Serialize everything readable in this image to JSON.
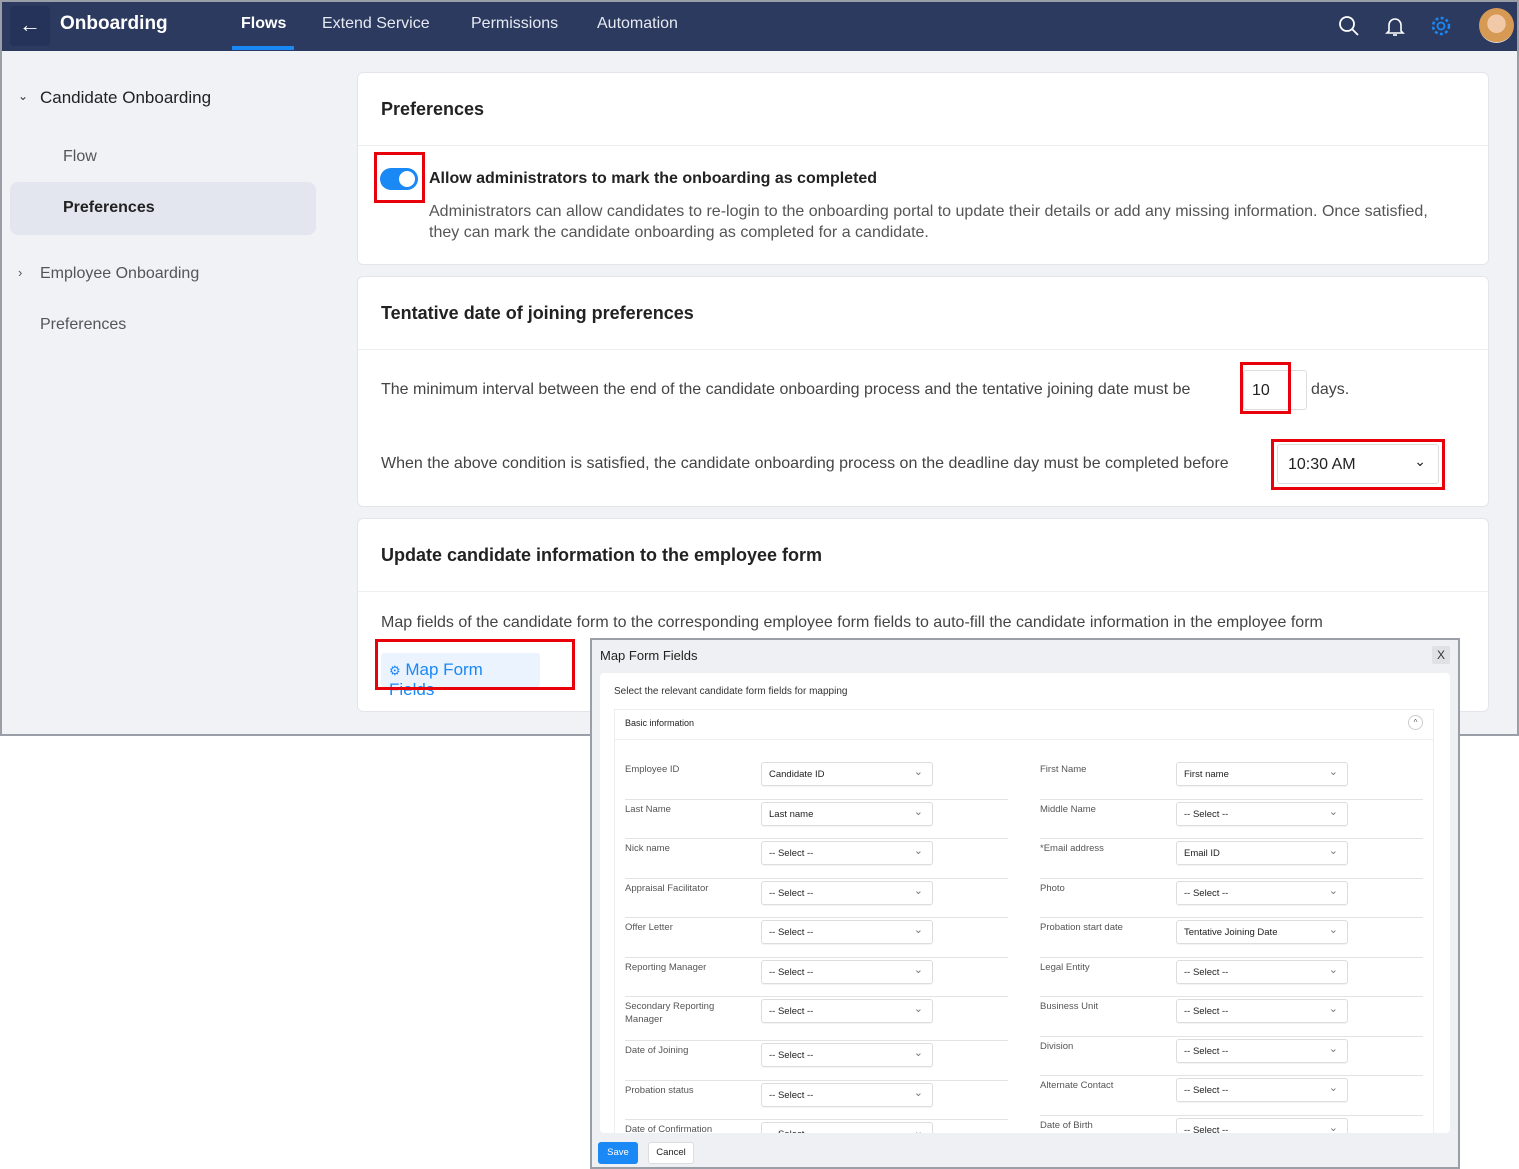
{
  "header": {
    "back_icon": "arrow-left-icon",
    "title": "Onboarding",
    "tabs": [
      "Flows",
      "Extend Service",
      "Permissions",
      "Automation"
    ],
    "active_tab": "Flows",
    "accent": "#1a88f5"
  },
  "sidebar": {
    "group1": "Candidate Onboarding",
    "group1_items": [
      "Flow",
      "Preferences"
    ],
    "group2": "Employee Onboarding",
    "group2_items": [
      "Preferences"
    ]
  },
  "preferences": {
    "title": "Preferences",
    "toggle_on": true,
    "toggle_label": "Allow administrators to mark the onboarding as completed",
    "description": "Administrators can allow candidates to re-login to the onboarding portal to update their details or add any missing information. Once satisfied, they can mark the candidate onboarding as completed for a candidate."
  },
  "joining": {
    "title": "Tentative date of joining preferences",
    "interval_text": "The minimum interval between the end of the candidate onboarding process and the tentative joining date must be",
    "interval_value": "10",
    "days": "days.",
    "deadline_text": "When the above condition is satisfied, the candidate onboarding process on the deadline day must be completed before",
    "deadline_value": "10:30 AM"
  },
  "update": {
    "title": "Update candidate information to the employee form",
    "description": "Map fields of the candidate form to the corresponding employee form fields to auto-fill the candidate information in the employee form",
    "map_button": "Map Form Fields"
  },
  "modal": {
    "title": "Map Form Fields",
    "close": "X",
    "description": "Select the relevant candidate form fields for mapping",
    "section": "Basic information",
    "collapse": "^",
    "left": [
      {
        "label": "Employee ID",
        "value": "Candidate ID"
      },
      {
        "label": "Last Name",
        "value": "Last name"
      },
      {
        "label": "Nick name",
        "value": "-- Select --"
      },
      {
        "label": "Appraisal Facilitator",
        "value": "-- Select --"
      },
      {
        "label": "Offer Letter",
        "value": "-- Select --"
      },
      {
        "label": "Reporting Manager",
        "value": "-- Select --"
      },
      {
        "label": "Secondary Reporting Manager",
        "value": "-- Select --"
      },
      {
        "label": "Date of Joining",
        "value": "-- Select --"
      },
      {
        "label": "Probation status",
        "value": "-- Select --"
      },
      {
        "label": "Date of Confirmation",
        "value": "-- Select --"
      }
    ],
    "right": [
      {
        "label": "First Name",
        "value": "First name"
      },
      {
        "label": "Middle Name",
        "value": "-- Select --"
      },
      {
        "label": "*Email address",
        "value": "Email ID"
      },
      {
        "label": "Photo",
        "value": "-- Select --"
      },
      {
        "label": "Probation start date",
        "value": "Tentative Joining Date"
      },
      {
        "label": "Legal Entity",
        "value": "-- Select --"
      },
      {
        "label": "Business Unit",
        "value": "-- Select --"
      },
      {
        "label": "Division",
        "value": "-- Select --"
      },
      {
        "label": "Alternate Contact",
        "value": "-- Select --"
      },
      {
        "label": "Date of Birth",
        "value": "-- Select --"
      }
    ],
    "save": "Save",
    "cancel": "Cancel"
  }
}
